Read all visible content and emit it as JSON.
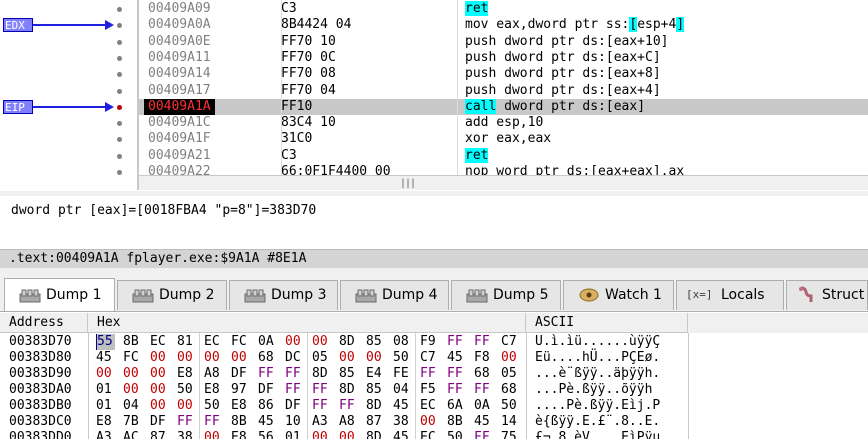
{
  "registers": [
    {
      "name": "EDX",
      "row": 1
    },
    {
      "name": "EIP",
      "row": 6
    }
  ],
  "disasm": {
    "rows": [
      {
        "addr": "00409A09",
        "bytes": "C3",
        "instr_parts": [
          {
            "t": "ret",
            "hl": "ret"
          }
        ]
      },
      {
        "addr": "00409A0A",
        "bytes": "8B4424 04",
        "instr_parts": [
          {
            "t": "mov eax,dword ptr ss:"
          },
          {
            "t": "[",
            "hl": "b"
          },
          {
            "t": "esp+4"
          },
          {
            "t": "]",
            "hl": "b"
          }
        ]
      },
      {
        "addr": "00409A0E",
        "bytes": "FF70 10",
        "instr_parts": [
          {
            "t": "push dword ptr ds:[eax+10]"
          }
        ]
      },
      {
        "addr": "00409A11",
        "bytes": "FF70 0C",
        "instr_parts": [
          {
            "t": "push dword ptr ds:[eax+C]"
          }
        ]
      },
      {
        "addr": "00409A14",
        "bytes": "FF70 08",
        "instr_parts": [
          {
            "t": "push dword ptr ds:[eax+8]"
          }
        ]
      },
      {
        "addr": "00409A17",
        "bytes": "FF70 04",
        "instr_parts": [
          {
            "t": "push dword ptr ds:[eax+4]"
          }
        ]
      },
      {
        "addr": "00409A1A",
        "bytes": "FF10",
        "instr_parts": [
          {
            "t": "call",
            "hl": "ret"
          },
          {
            "t": " dword ptr ds:[eax]"
          }
        ],
        "current": true
      },
      {
        "addr": "00409A1C",
        "bytes": "83C4 10",
        "instr_parts": [
          {
            "t": "add esp,10"
          }
        ]
      },
      {
        "addr": "00409A1F",
        "bytes": "31C0",
        "instr_parts": [
          {
            "t": "xor eax,eax"
          }
        ]
      },
      {
        "addr": "00409A21",
        "bytes": "C3",
        "instr_parts": [
          {
            "t": "ret",
            "hl": "ret"
          }
        ]
      },
      {
        "addr": "00409A22",
        "bytes": "66:0F1F4400 00",
        "instr_parts": [
          {
            "t": "nop word ptr ds:[eax+eax],ax"
          }
        ]
      }
    ]
  },
  "scrollbar_grip": "|||",
  "info": {
    "line": "dword ptr [eax]=[0018FBA4 \"p=8\"]=383D70",
    "location": ".text:00409A1A fplayer.exe:$9A1A #8E1A"
  },
  "tabs": [
    {
      "label": "Dump 1",
      "icon": "dump-icon",
      "active": true
    },
    {
      "label": "Dump 2",
      "icon": "dump-icon"
    },
    {
      "label": "Dump 3",
      "icon": "dump-icon"
    },
    {
      "label": "Dump 4",
      "icon": "dump-icon"
    },
    {
      "label": "Dump 5",
      "icon": "dump-icon"
    },
    {
      "label": "Watch 1",
      "icon": "watch-icon"
    },
    {
      "label": "Locals",
      "icon": "locals-icon",
      "icon_text": "[x=]"
    },
    {
      "label": "Struct",
      "icon": "struct-icon"
    }
  ],
  "dump": {
    "headers": {
      "address": "Address",
      "hex": "Hex",
      "ascii": "ASCII"
    },
    "rows": [
      {
        "addr": "00383D70",
        "bytes": [
          "55",
          "8B",
          "EC",
          "81",
          "EC",
          "FC",
          "0A",
          "00",
          "00",
          "8D",
          "85",
          "08",
          "F9",
          "FF",
          "FF",
          "C7"
        ],
        "ascii": "U.ì.ìü......ùÿÿÇ"
      },
      {
        "addr": "00383D80",
        "bytes": [
          "45",
          "FC",
          "00",
          "00",
          "00",
          "00",
          "68",
          "DC",
          "05",
          "00",
          "00",
          "50",
          "C7",
          "45",
          "F8",
          "00"
        ],
        "ascii": "Eü....hÜ...PÇEø."
      },
      {
        "addr": "00383D90",
        "bytes": [
          "00",
          "00",
          "00",
          "E8",
          "A8",
          "DF",
          "FF",
          "FF",
          "8D",
          "85",
          "E4",
          "FE",
          "FF",
          "FF",
          "68",
          "05"
        ],
        "ascii": "...è¨ßÿÿ..äþÿÿh."
      },
      {
        "addr": "00383DA0",
        "bytes": [
          "01",
          "00",
          "00",
          "50",
          "E8",
          "97",
          "DF",
          "FF",
          "FF",
          "8D",
          "85",
          "04",
          "F5",
          "FF",
          "FF",
          "68"
        ],
        "ascii": "...Pè.ßÿÿ..õÿÿh"
      },
      {
        "addr": "00383DB0",
        "bytes": [
          "01",
          "04",
          "00",
          "00",
          "50",
          "E8",
          "86",
          "DF",
          "FF",
          "FF",
          "8D",
          "45",
          "EC",
          "6A",
          "0A",
          "50"
        ],
        "ascii": "....Pè.ßÿÿ.Eìj.P"
      },
      {
        "addr": "00383DC0",
        "bytes": [
          "E8",
          "7B",
          "DF",
          "FF",
          "FF",
          "8B",
          "45",
          "10",
          "A3",
          "A8",
          "87",
          "38",
          "00",
          "8B",
          "45",
          "14"
        ],
        "ascii": "è{ßÿÿ.E.£¨.8..E."
      },
      {
        "addr": "00383DD0",
        "bytes": [
          "A3",
          "AC",
          "87",
          "38",
          "00",
          "E8",
          "56",
          "01",
          "00",
          "00",
          "8D",
          "45",
          "EC",
          "50",
          "FF",
          "75"
        ],
        "ascii": "£¬.8.èV....EìPÿu"
      }
    ]
  },
  "colors": {
    "register_label_bg": "#8080ff",
    "register_arrow": "#2020e0",
    "eip_address_bg": "#000000",
    "eip_address_fg": "#ff3030",
    "keyword_highlight": "#00ffff",
    "selected_row": "#c8c8c8",
    "hex_zero": "#c00000",
    "hex_ff": "#800080",
    "hex_other": "#000000",
    "selected_byte_bg": "#c0c0c0",
    "selected_byte_fg": "#000080"
  }
}
